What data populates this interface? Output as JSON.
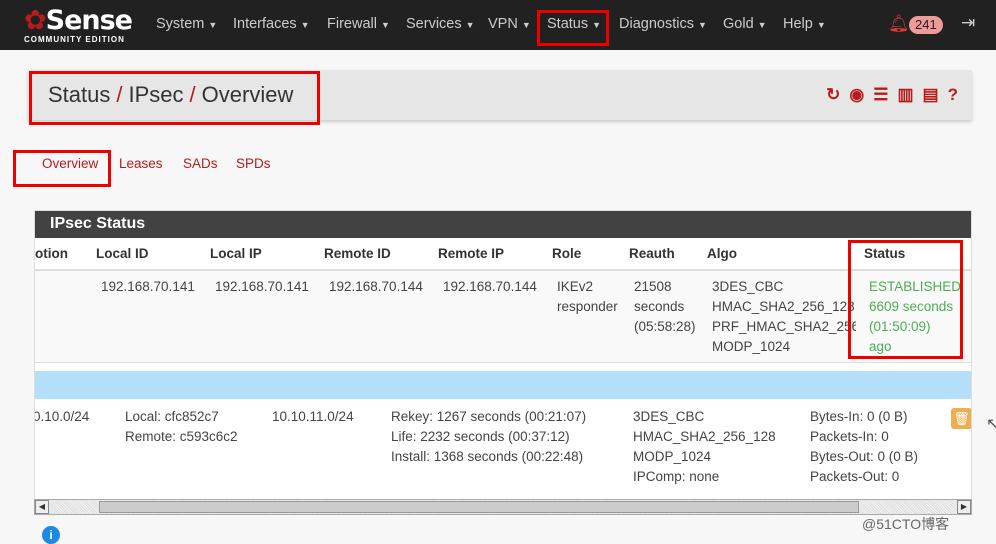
{
  "brand": {
    "name_pre": "S",
    "name_o": "o",
    "name": "Sense",
    "edition": "COMMUNITY EDITION"
  },
  "nav": {
    "items": [
      "System",
      "Interfaces",
      "Firewall",
      "Services",
      "VPN",
      "Status",
      "Diagnostics",
      "Gold",
      "Help"
    ],
    "notifications": "241"
  },
  "breadcrumb": [
    "Status",
    "IPsec",
    "Overview"
  ],
  "tabs": [
    "Overview",
    "Leases",
    "SADs",
    "SPDs"
  ],
  "panel": {
    "title": "IPsec Status",
    "headers": [
      "otion",
      "Local ID",
      "Local IP",
      "Remote ID",
      "Remote IP",
      "Role",
      "Reauth",
      "Algo",
      "Status"
    ],
    "row": {
      "local_id": "192.168.70.141",
      "local_ip": "192.168.70.141",
      "remote_id": "192.168.70.144",
      "remote_ip": "192.168.70.144",
      "role": [
        "IKEv2",
        "responder"
      ],
      "reauth": [
        "21508",
        "seconds",
        "(05:58:28)"
      ],
      "algo": [
        "3DES_CBC",
        "HMAC_SHA2_256_128",
        "PRF_HMAC_SHA2_256",
        "MODP_1024"
      ],
      "status": [
        "ESTABLISHED",
        "6609 seconds",
        "(01:50:09)",
        "ago"
      ]
    },
    "child": {
      "local_net": "0.10.0/24",
      "spi": [
        "Local: cfc852c7",
        "Remote: c593c6c2"
      ],
      "remote_net": "10.10.11.0/24",
      "times": [
        "Rekey: 1267 seconds (00:21:07)",
        "Life: 2232 seconds (00:37:12)",
        "Install: 1368 seconds (00:22:48)"
      ],
      "algo": [
        "3DES_CBC",
        "HMAC_SHA2_256_128",
        "MODP_1024",
        "IPComp: none"
      ],
      "stats": [
        "Bytes-In: 0 (0 B)",
        "Packets-In: 0",
        "Bytes-Out: 0 (0 B)",
        "Packets-Out: 0"
      ]
    }
  },
  "watermark": "@51CTO博客",
  "colors": {
    "accent": "#b71c1c",
    "established": "#4caf50",
    "navbar": "#212121",
    "highlight_row": "#b3e0f8",
    "annotation": "#ee0000"
  }
}
